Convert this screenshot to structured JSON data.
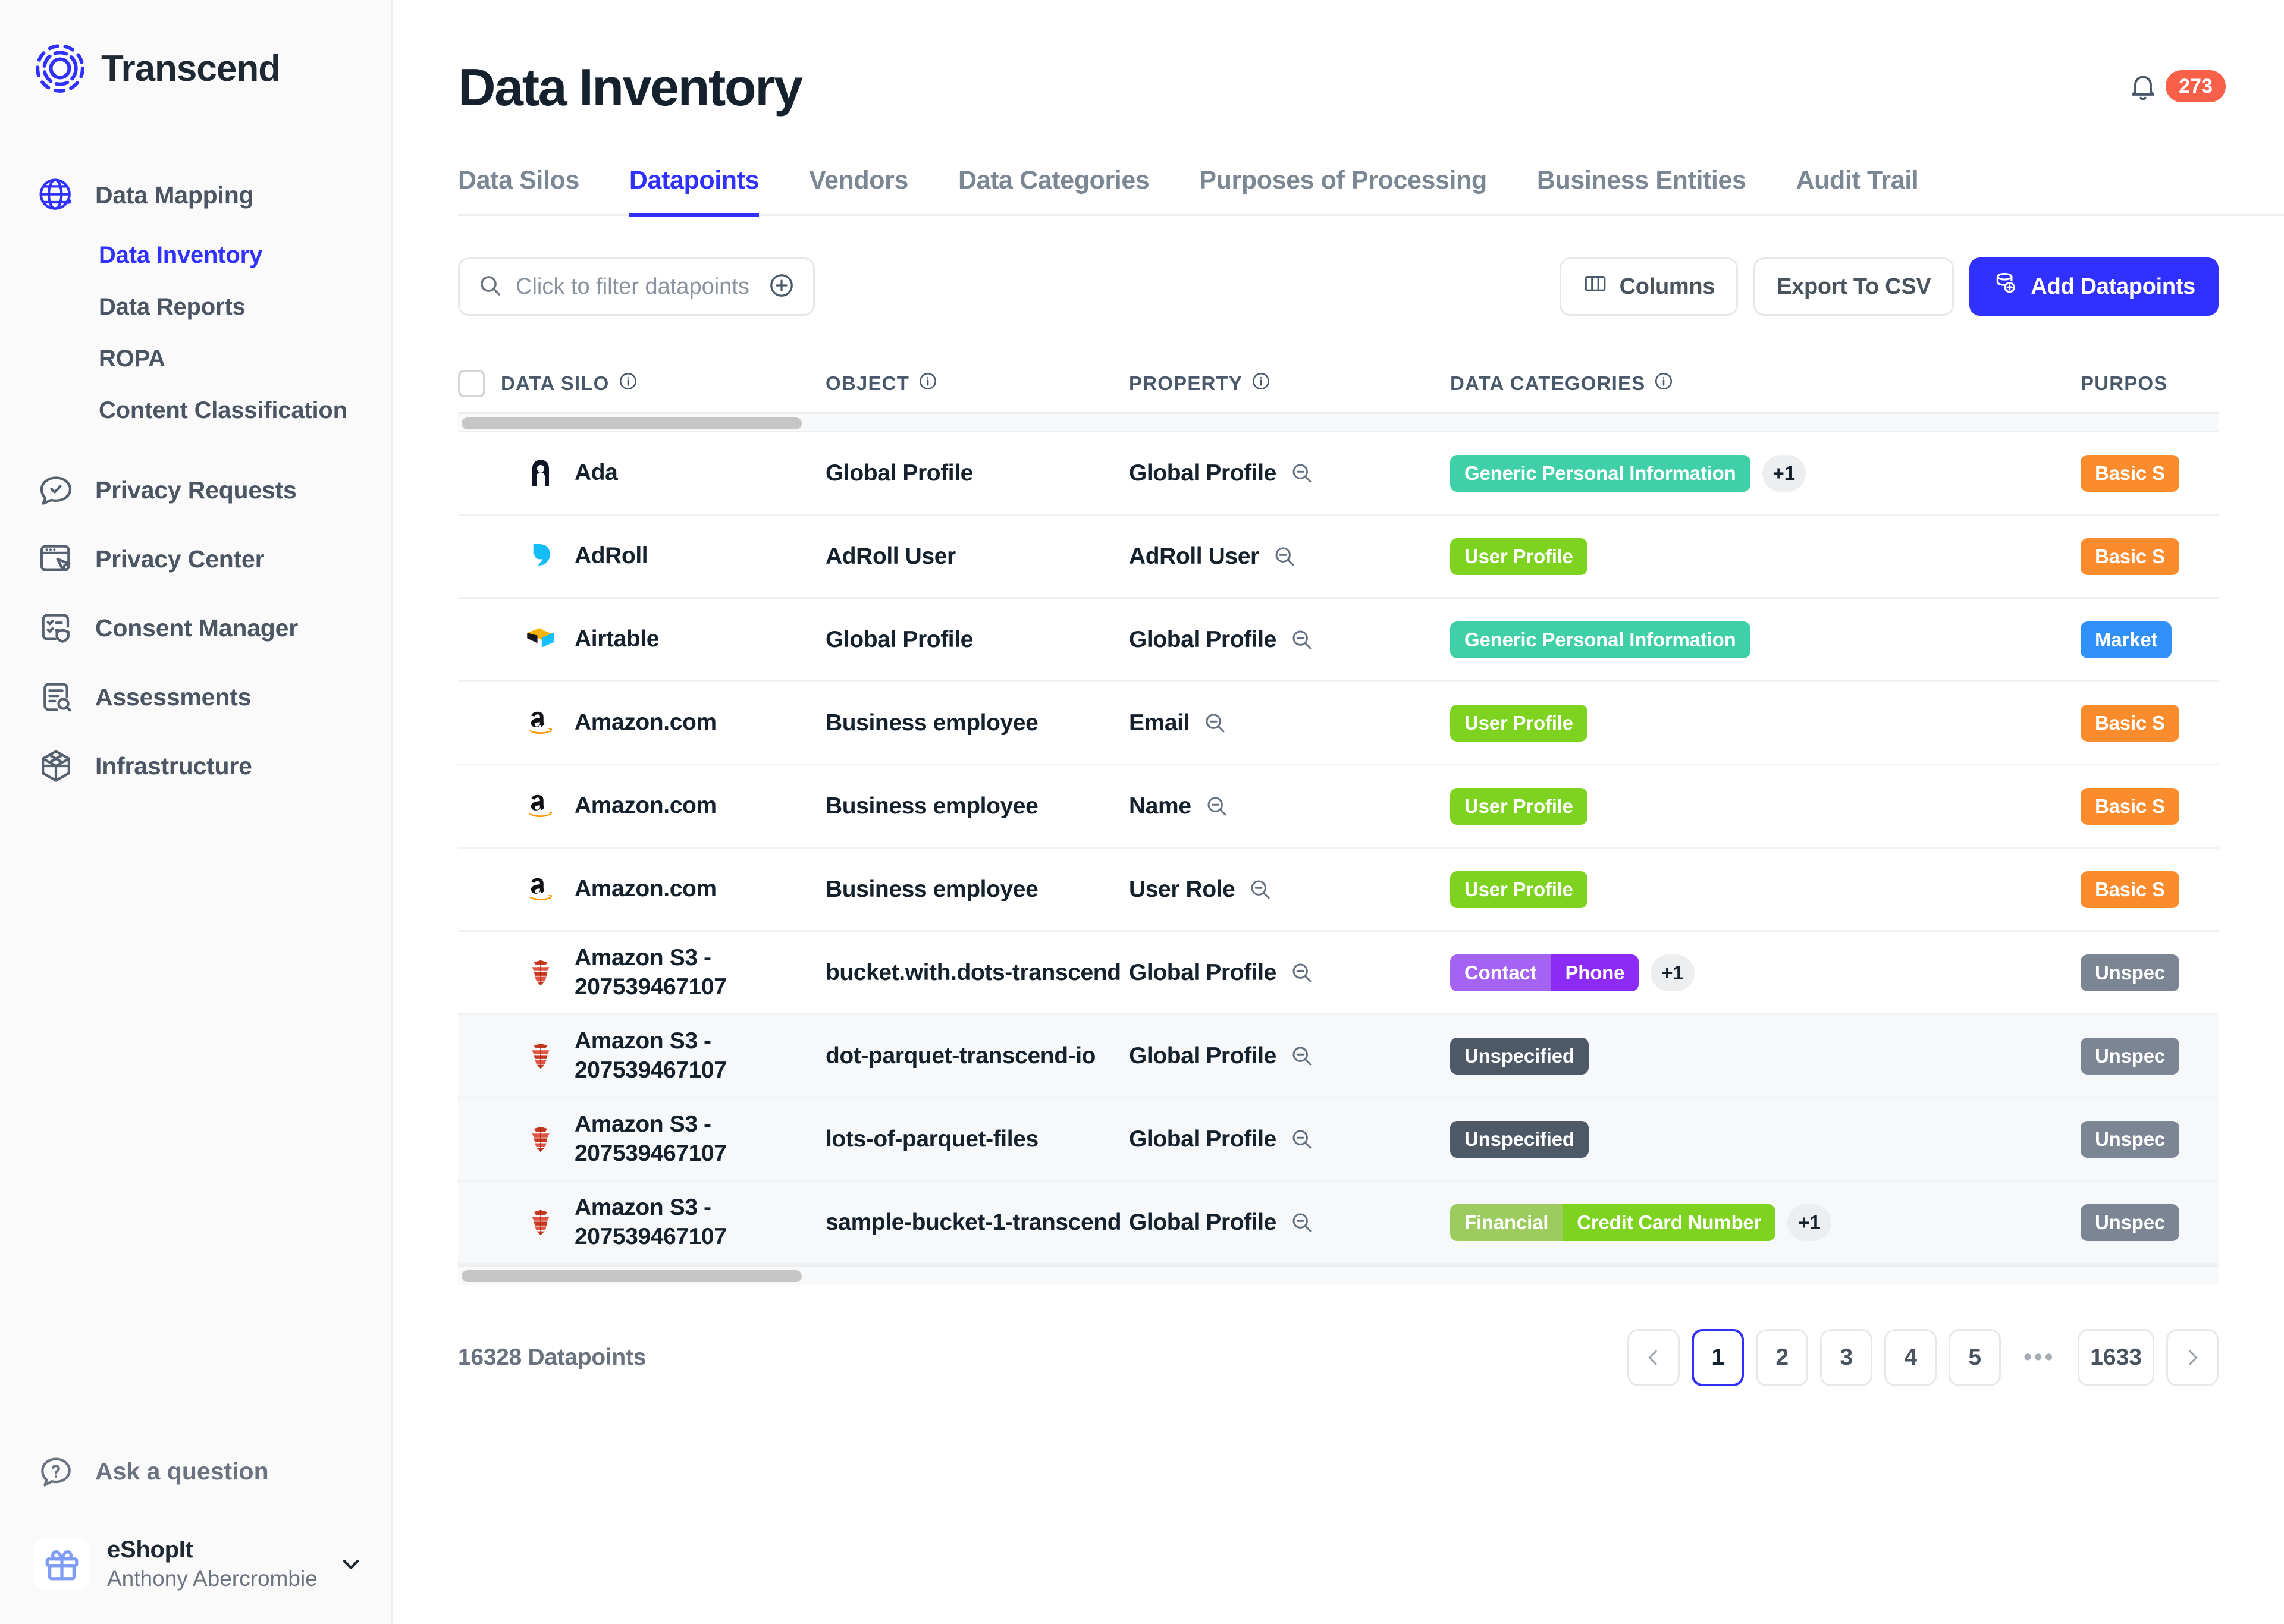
{
  "brand": {
    "name": "Transcend"
  },
  "sidebar": {
    "nav": [
      {
        "label": "Data Mapping",
        "icon": "globe-icon",
        "children": [
          {
            "label": "Data Inventory",
            "active": true
          },
          {
            "label": "Data Reports",
            "active": false
          },
          {
            "label": "ROPA",
            "active": false
          },
          {
            "label": "Content Classification",
            "active": false
          }
        ]
      },
      {
        "label": "Privacy Requests",
        "icon": "chat-check-icon",
        "children": []
      },
      {
        "label": "Privacy Center",
        "icon": "browser-cursor-icon",
        "children": []
      },
      {
        "label": "Consent Manager",
        "icon": "shield-checklist-icon",
        "children": []
      },
      {
        "label": "Assessments",
        "icon": "document-search-icon",
        "children": []
      },
      {
        "label": "Infrastructure",
        "icon": "cube-icon",
        "children": []
      }
    ],
    "ask": {
      "label": "Ask a question",
      "icon": "question-bubble-icon"
    },
    "account": {
      "org": "eShopIt",
      "user": "Anthony Abercrombie",
      "avatar_icon": "gift-icon",
      "chevron_icon": "chevron-down-icon"
    }
  },
  "header": {
    "title": "Data Inventory",
    "notifications": {
      "count": "273",
      "icon": "bell-icon"
    }
  },
  "tabs": [
    {
      "label": "Data Silos",
      "active": false
    },
    {
      "label": "Datapoints",
      "active": true
    },
    {
      "label": "Vendors",
      "active": false
    },
    {
      "label": "Data Categories",
      "active": false
    },
    {
      "label": "Purposes of Processing",
      "active": false
    },
    {
      "label": "Business Entities",
      "active": false
    },
    {
      "label": "Audit Trail",
      "active": false
    }
  ],
  "toolbar": {
    "filter_placeholder": "Click to filter datapoints",
    "search_icon": "search-icon",
    "add_filter_icon": "plus-circle-icon",
    "columns_label": "Columns",
    "columns_icon": "columns-icon",
    "export_label": "Export To CSV",
    "add_label": "Add Datapoints",
    "add_icon": "database-plus-icon"
  },
  "table": {
    "columns": [
      {
        "key": "silo",
        "label": "DATA SILO",
        "info_icon": "info-icon"
      },
      {
        "key": "object",
        "label": "OBJECT",
        "info_icon": "info-icon"
      },
      {
        "key": "property",
        "label": "PROPERTY",
        "info_icon": "info-icon"
      },
      {
        "key": "categories",
        "label": "DATA CATEGORIES",
        "info_icon": "info-icon"
      },
      {
        "key": "purposes",
        "label": "PURPOS",
        "info_icon": ""
      }
    ],
    "rows": [
      {
        "silo": "Ada",
        "logo": "ada-logo",
        "object": "Global Profile",
        "property": "Global Profile",
        "categories": [
          {
            "label": "Generic Personal Information",
            "color": "#3fd0a8"
          }
        ],
        "categories_more": "+1",
        "purposes": [
          {
            "label": "Basic S",
            "color": "#fb8c2e"
          }
        ],
        "hover": false
      },
      {
        "silo": "AdRoll",
        "logo": "adroll-logo",
        "object": "AdRoll User",
        "property": "AdRoll User",
        "categories": [
          {
            "label": "User Profile",
            "color": "#7ed321"
          }
        ],
        "categories_more": "",
        "purposes": [
          {
            "label": "Basic S",
            "color": "#fb8c2e"
          }
        ],
        "hover": false
      },
      {
        "silo": "Airtable",
        "logo": "airtable-logo",
        "object": "Global Profile",
        "property": "Global Profile",
        "categories": [
          {
            "label": "Generic Personal Information",
            "color": "#3fd0a8"
          }
        ],
        "categories_more": "",
        "purposes": [
          {
            "label": "Market",
            "color": "#3191fb"
          }
        ],
        "hover": false
      },
      {
        "silo": "Amazon.com",
        "logo": "amazon-logo",
        "object": "Business employee",
        "property": "Email",
        "categories": [
          {
            "label": "User Profile",
            "color": "#7ed321"
          }
        ],
        "categories_more": "",
        "purposes": [
          {
            "label": "Basic S",
            "color": "#fb8c2e"
          }
        ],
        "hover": false
      },
      {
        "silo": "Amazon.com",
        "logo": "amazon-logo",
        "object": "Business employee",
        "property": "Name",
        "categories": [
          {
            "label": "User Profile",
            "color": "#7ed321"
          }
        ],
        "categories_more": "",
        "purposes": [
          {
            "label": "Basic S",
            "color": "#fb8c2e"
          }
        ],
        "hover": false
      },
      {
        "silo": "Amazon.com",
        "logo": "amazon-logo",
        "object": "Business employee",
        "property": "User Role",
        "categories": [
          {
            "label": "User Profile",
            "color": "#7ed321"
          }
        ],
        "categories_more": "",
        "purposes": [
          {
            "label": "Basic S",
            "color": "#fb8c2e"
          }
        ],
        "hover": false
      },
      {
        "silo": "Amazon S3 - 207539467107",
        "logo": "amazon-s3-logo",
        "object": "bucket.with.dots-transcend",
        "property": "Global Profile",
        "categories": [
          {
            "label": "Contact",
            "color": "#a463f2"
          },
          {
            "label": "Phone",
            "color": "#8b2bf5"
          }
        ],
        "categories_more": "+1",
        "purposes": [
          {
            "label": "Unspec",
            "color": "#7b8593"
          }
        ],
        "hover": false
      },
      {
        "silo": "Amazon S3 - 207539467107",
        "logo": "amazon-s3-logo",
        "object": "dot-parquet-transcend-io",
        "property": "Global Profile",
        "categories": [
          {
            "label": "Unspecified",
            "color": "#4e5968"
          }
        ],
        "categories_more": "",
        "purposes": [
          {
            "label": "Unspec",
            "color": "#7b8593"
          }
        ],
        "hover": true
      },
      {
        "silo": "Amazon S3 - 207539467107",
        "logo": "amazon-s3-logo",
        "object": "lots-of-parquet-files",
        "property": "Global Profile",
        "categories": [
          {
            "label": "Unspecified",
            "color": "#4e5968"
          }
        ],
        "categories_more": "",
        "purposes": [
          {
            "label": "Unspec",
            "color": "#7b8593"
          }
        ],
        "hover": true
      },
      {
        "silo": "Amazon S3 - 207539467107",
        "logo": "amazon-s3-logo",
        "object": "sample-bucket-1-transcend",
        "property": "Global Profile",
        "categories": [
          {
            "label": "Financial",
            "color": "#9ccc5f"
          },
          {
            "label": "Credit Card Number",
            "color": "#7ed321"
          }
        ],
        "categories_more": "+1",
        "purposes": [
          {
            "label": "Unspec",
            "color": "#7b8593"
          }
        ],
        "hover": true
      }
    ]
  },
  "footer": {
    "count_label": "16328 Datapoints",
    "pagination": {
      "prev_icon": "chevron-left-icon",
      "next_icon": "chevron-right-icon",
      "pages": [
        "1",
        "2",
        "3",
        "4",
        "5",
        "…",
        "1633"
      ],
      "current": "1"
    }
  },
  "colors": {
    "accent": "#3131ff",
    "badge_red": "#f8604a",
    "text_dark": "#16212e",
    "text_muted": "#6b7280"
  }
}
